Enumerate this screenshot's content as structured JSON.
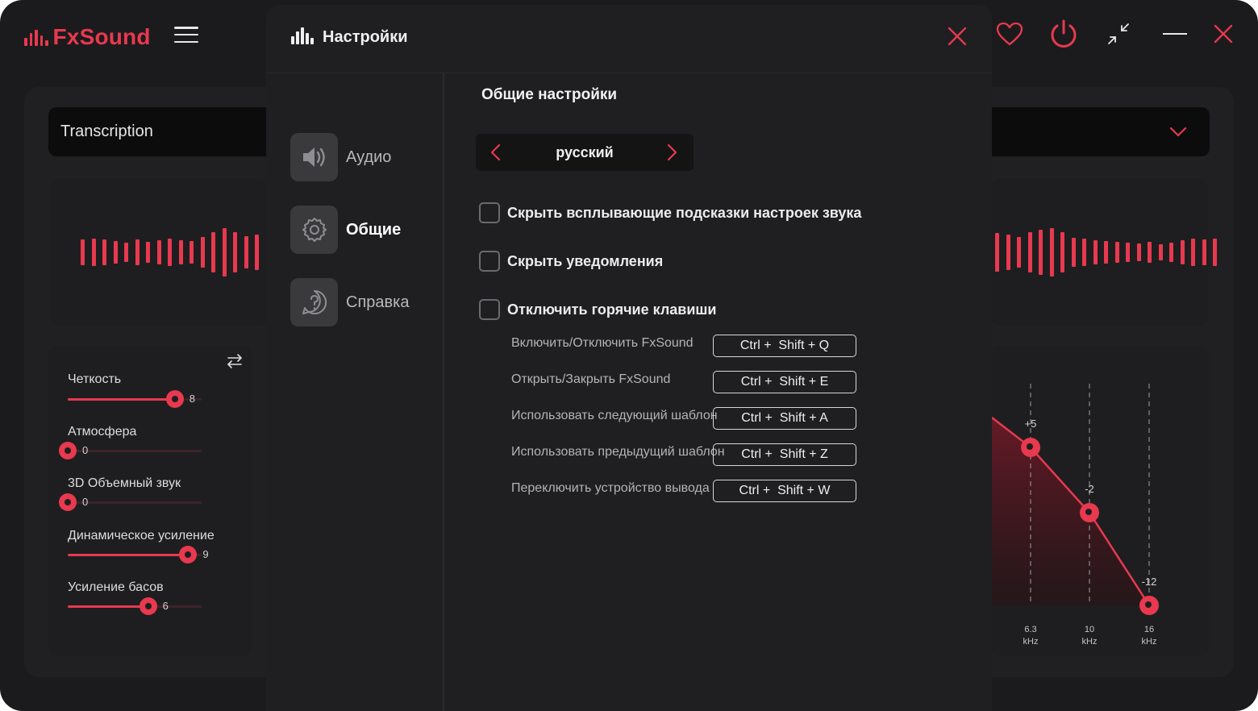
{
  "app": {
    "logo_text": "FxSound",
    "accent_color": "#e8394f",
    "titlebar_icons": [
      "menu-icon",
      "heart-icon",
      "power-icon",
      "minimize-view-icon",
      "minimize-icon",
      "close-icon"
    ]
  },
  "preset": {
    "name": "Transcription"
  },
  "effects": [
    {
      "label": "Четкость",
      "value": "8",
      "level": 0.8
    },
    {
      "label": "Атмосфера",
      "value": "0",
      "level": 0.0
    },
    {
      "label": "3D Объемный звук",
      "value": "0",
      "level": 0.0
    },
    {
      "label": "Динамическое усиление",
      "value": "9",
      "level": 0.9
    },
    {
      "label": "Усиление басов",
      "value": "6",
      "level": 0.6
    }
  ],
  "eq": {
    "bands": [
      {
        "freq": "6.3",
        "unit": "kHz",
        "gain": "+5"
      },
      {
        "freq": "10",
        "unit": "kHz",
        "gain": "-2"
      },
      {
        "freq": "16",
        "unit": "kHz",
        "gain": "-12"
      }
    ]
  },
  "settings": {
    "title": "Настройки",
    "nav": [
      {
        "label": "Аудио",
        "icon": "speaker-icon",
        "active": false
      },
      {
        "label": "Общие",
        "icon": "gear-icon",
        "active": true
      },
      {
        "label": "Справка",
        "icon": "help-icon",
        "active": false
      }
    ],
    "section_title": "Общие настройки",
    "language": "русский",
    "checkboxes": [
      {
        "label": "Скрыть всплывающие подсказки настроек звука",
        "checked": false
      },
      {
        "label": "Скрыть уведомления",
        "checked": false
      },
      {
        "label": "Отключить горячие клавиши",
        "checked": false
      }
    ],
    "hotkeys": [
      {
        "label": "Включить/Отключить FxSound",
        "keys": "Ctrl +  Shift + Q"
      },
      {
        "label": "Открыть/Закрыть FxSound",
        "keys": "Ctrl +  Shift + E"
      },
      {
        "label": "Использовать следующий шаблон",
        "keys": "Ctrl +  Shift + A"
      },
      {
        "label": "Использовать предыдущий шаблон",
        "keys": "Ctrl +  Shift + Z"
      },
      {
        "label": "Переключить устройство вывода",
        "keys": "Ctrl +  Shift + W"
      }
    ]
  }
}
